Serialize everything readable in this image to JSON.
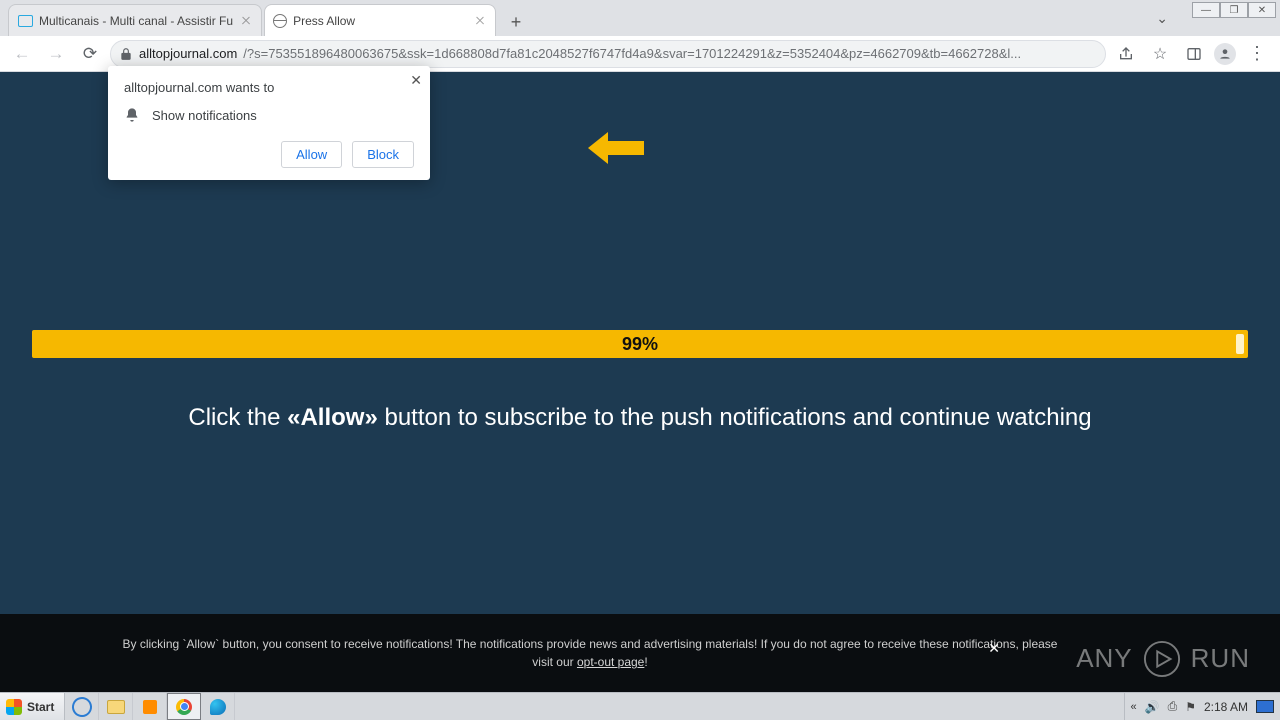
{
  "tabs": [
    {
      "title": "Multicanais - Multi canal - Assistir Fu"
    },
    {
      "title": "Press Allow"
    }
  ],
  "url": {
    "host": "alltopjournal.com",
    "rest": "/?s=753551896480063675&ssk=1d668808d7fa81c2048527f6747fd4a9&svar=1701224291&z=5352404&pz=4662709&tb=4662728&l..."
  },
  "permission": {
    "wants": "alltopjournal.com wants to",
    "show": "Show notifications",
    "allow": "Allow",
    "block": "Block"
  },
  "progress": {
    "pct": "99%"
  },
  "prompt": {
    "pre": "Click the ",
    "allow": "«Allow»",
    "post": " button to subscribe to the push notifications and continue watching"
  },
  "footer": {
    "line": "By clicking `Allow` button, you consent to receive notifications! The notifications provide news and advertising materials! If you do not agree to receive these notifications, please visit our ",
    "opt": "opt-out page",
    "excl": "!"
  },
  "watermark": {
    "a": "ANY",
    "b": "RUN"
  },
  "taskbar": {
    "start": "Start",
    "clock": "2:18 AM"
  }
}
